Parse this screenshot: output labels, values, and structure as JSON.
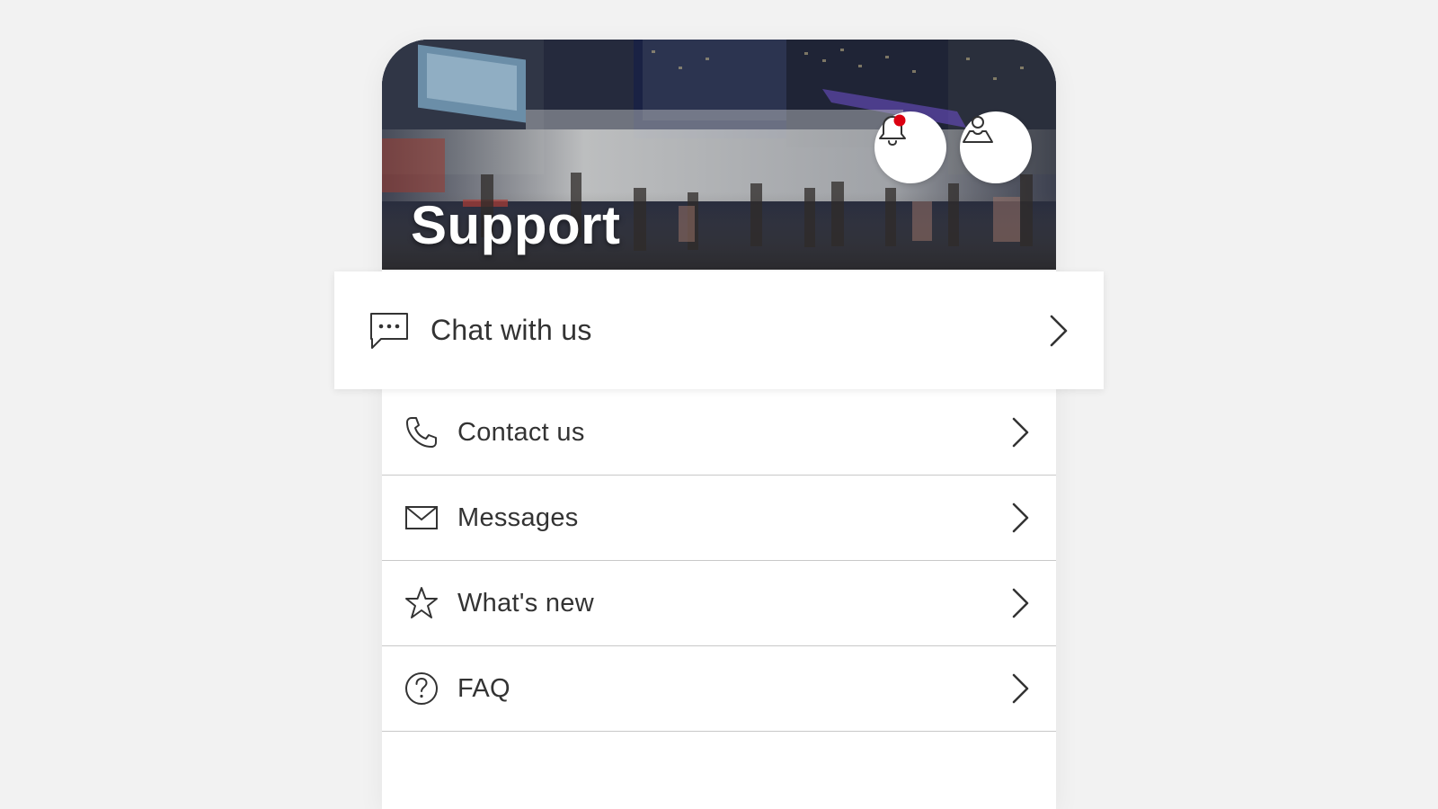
{
  "header": {
    "title": "Support",
    "notification_icon": "bell-icon",
    "profile_icon": "user-profile-icon",
    "notification_dot_color": "#db0011"
  },
  "featured_item": {
    "label": "Chat with us",
    "icon": "chat-bubble-icon"
  },
  "menu": {
    "items": [
      {
        "label": "Contact us",
        "icon": "phone-icon"
      },
      {
        "label": "Messages",
        "icon": "envelope-icon"
      },
      {
        "label": "What's new",
        "icon": "star-icon"
      },
      {
        "label": "FAQ",
        "icon": "question-circle-icon"
      }
    ]
  },
  "colors": {
    "background": "#f2f2f2",
    "surface": "#ffffff",
    "text": "#333333",
    "divider": "#c8c8c8",
    "accent": "#db0011"
  }
}
